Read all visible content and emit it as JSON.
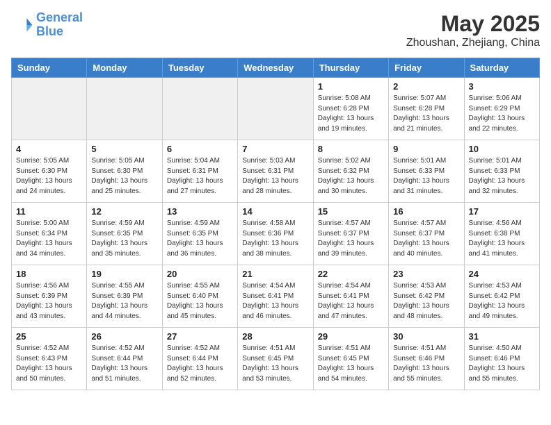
{
  "header": {
    "logo_line1": "General",
    "logo_line2": "Blue",
    "month": "May 2025",
    "location": "Zhoushan, Zhejiang, China"
  },
  "days_of_week": [
    "Sunday",
    "Monday",
    "Tuesday",
    "Wednesday",
    "Thursday",
    "Friday",
    "Saturday"
  ],
  "weeks": [
    [
      {
        "day": "",
        "empty": true
      },
      {
        "day": "",
        "empty": true
      },
      {
        "day": "",
        "empty": true
      },
      {
        "day": "",
        "empty": true
      },
      {
        "day": "1",
        "sunrise": "5:08 AM",
        "sunset": "6:28 PM",
        "daylight": "13 hours and 19 minutes."
      },
      {
        "day": "2",
        "sunrise": "5:07 AM",
        "sunset": "6:28 PM",
        "daylight": "13 hours and 21 minutes."
      },
      {
        "day": "3",
        "sunrise": "5:06 AM",
        "sunset": "6:29 PM",
        "daylight": "13 hours and 22 minutes."
      }
    ],
    [
      {
        "day": "4",
        "sunrise": "5:05 AM",
        "sunset": "6:30 PM",
        "daylight": "13 hours and 24 minutes."
      },
      {
        "day": "5",
        "sunrise": "5:05 AM",
        "sunset": "6:30 PM",
        "daylight": "13 hours and 25 minutes."
      },
      {
        "day": "6",
        "sunrise": "5:04 AM",
        "sunset": "6:31 PM",
        "daylight": "13 hours and 27 minutes."
      },
      {
        "day": "7",
        "sunrise": "5:03 AM",
        "sunset": "6:31 PM",
        "daylight": "13 hours and 28 minutes."
      },
      {
        "day": "8",
        "sunrise": "5:02 AM",
        "sunset": "6:32 PM",
        "daylight": "13 hours and 30 minutes."
      },
      {
        "day": "9",
        "sunrise": "5:01 AM",
        "sunset": "6:33 PM",
        "daylight": "13 hours and 31 minutes."
      },
      {
        "day": "10",
        "sunrise": "5:01 AM",
        "sunset": "6:33 PM",
        "daylight": "13 hours and 32 minutes."
      }
    ],
    [
      {
        "day": "11",
        "sunrise": "5:00 AM",
        "sunset": "6:34 PM",
        "daylight": "13 hours and 34 minutes."
      },
      {
        "day": "12",
        "sunrise": "4:59 AM",
        "sunset": "6:35 PM",
        "daylight": "13 hours and 35 minutes."
      },
      {
        "day": "13",
        "sunrise": "4:59 AM",
        "sunset": "6:35 PM",
        "daylight": "13 hours and 36 minutes."
      },
      {
        "day": "14",
        "sunrise": "4:58 AM",
        "sunset": "6:36 PM",
        "daylight": "13 hours and 38 minutes."
      },
      {
        "day": "15",
        "sunrise": "4:57 AM",
        "sunset": "6:37 PM",
        "daylight": "13 hours and 39 minutes."
      },
      {
        "day": "16",
        "sunrise": "4:57 AM",
        "sunset": "6:37 PM",
        "daylight": "13 hours and 40 minutes."
      },
      {
        "day": "17",
        "sunrise": "4:56 AM",
        "sunset": "6:38 PM",
        "daylight": "13 hours and 41 minutes."
      }
    ],
    [
      {
        "day": "18",
        "sunrise": "4:56 AM",
        "sunset": "6:39 PM",
        "daylight": "13 hours and 43 minutes."
      },
      {
        "day": "19",
        "sunrise": "4:55 AM",
        "sunset": "6:39 PM",
        "daylight": "13 hours and 44 minutes."
      },
      {
        "day": "20",
        "sunrise": "4:55 AM",
        "sunset": "6:40 PM",
        "daylight": "13 hours and 45 minutes."
      },
      {
        "day": "21",
        "sunrise": "4:54 AM",
        "sunset": "6:41 PM",
        "daylight": "13 hours and 46 minutes."
      },
      {
        "day": "22",
        "sunrise": "4:54 AM",
        "sunset": "6:41 PM",
        "daylight": "13 hours and 47 minutes."
      },
      {
        "day": "23",
        "sunrise": "4:53 AM",
        "sunset": "6:42 PM",
        "daylight": "13 hours and 48 minutes."
      },
      {
        "day": "24",
        "sunrise": "4:53 AM",
        "sunset": "6:42 PM",
        "daylight": "13 hours and 49 minutes."
      }
    ],
    [
      {
        "day": "25",
        "sunrise": "4:52 AM",
        "sunset": "6:43 PM",
        "daylight": "13 hours and 50 minutes."
      },
      {
        "day": "26",
        "sunrise": "4:52 AM",
        "sunset": "6:44 PM",
        "daylight": "13 hours and 51 minutes."
      },
      {
        "day": "27",
        "sunrise": "4:52 AM",
        "sunset": "6:44 PM",
        "daylight": "13 hours and 52 minutes."
      },
      {
        "day": "28",
        "sunrise": "4:51 AM",
        "sunset": "6:45 PM",
        "daylight": "13 hours and 53 minutes."
      },
      {
        "day": "29",
        "sunrise": "4:51 AM",
        "sunset": "6:45 PM",
        "daylight": "13 hours and 54 minutes."
      },
      {
        "day": "30",
        "sunrise": "4:51 AM",
        "sunset": "6:46 PM",
        "daylight": "13 hours and 55 minutes."
      },
      {
        "day": "31",
        "sunrise": "4:50 AM",
        "sunset": "6:46 PM",
        "daylight": "13 hours and 55 minutes."
      }
    ]
  ]
}
